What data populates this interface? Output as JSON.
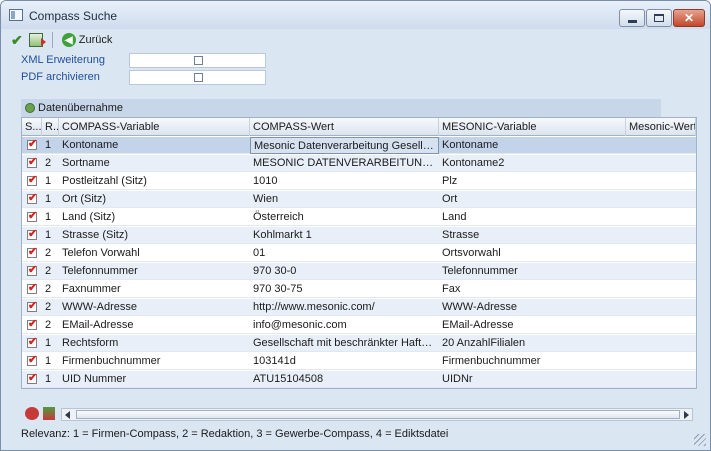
{
  "window": {
    "title": "Compass Suche"
  },
  "toolbar": {
    "back_label": "Zurück"
  },
  "fields": [
    {
      "label": "XML Erweiterung",
      "checked": false
    },
    {
      "label": "PDF archivieren",
      "checked": false
    }
  ],
  "panel": {
    "title": "Datenübernahme"
  },
  "grid": {
    "columns": [
      "S...",
      "R...",
      "COMPASS-Variable",
      "COMPASS-Wert",
      "MESONIC-Variable",
      "Mesonic-Wert"
    ],
    "rows": [
      {
        "checked": true,
        "r": "1",
        "var": "Kontoname",
        "val": "Mesonic Datenverarbeitung Gesellschaft...",
        "mvar": "Kontoname",
        "mval": ""
      },
      {
        "checked": true,
        "r": "2",
        "var": "Sortname",
        "val": "MESONIC DATENVERARBEITUNGS GESE...",
        "mvar": "Kontoname2",
        "mval": ""
      },
      {
        "checked": true,
        "r": "1",
        "var": "Postleitzahl (Sitz)",
        "val": "1010",
        "mvar": "Plz",
        "mval": ""
      },
      {
        "checked": true,
        "r": "1",
        "var": "Ort (Sitz)",
        "val": "Wien",
        "mvar": "Ort",
        "mval": ""
      },
      {
        "checked": true,
        "r": "1",
        "var": "Land (Sitz)",
        "val": "Österreich",
        "mvar": "Land",
        "mval": ""
      },
      {
        "checked": true,
        "r": "1",
        "var": "Strasse (Sitz)",
        "val": "Kohlmarkt 1",
        "mvar": "Strasse",
        "mval": ""
      },
      {
        "checked": true,
        "r": "2",
        "var": "Telefon Vorwahl",
        "val": "01",
        "mvar": "Ortsvorwahl",
        "mval": ""
      },
      {
        "checked": true,
        "r": "2",
        "var": "Telefonnummer",
        "val": "970 30-0",
        "mvar": "Telefonnummer",
        "mval": ""
      },
      {
        "checked": true,
        "r": "2",
        "var": "Faxnummer",
        "val": "970 30-75",
        "mvar": "Fax",
        "mval": ""
      },
      {
        "checked": true,
        "r": "2",
        "var": "WWW-Adresse",
        "val": "http://www.mesonic.com/",
        "mvar": "WWW-Adresse",
        "mval": ""
      },
      {
        "checked": true,
        "r": "2",
        "var": "EMail-Adresse",
        "val": "info@mesonic.com",
        "mvar": "EMail-Adresse",
        "mval": ""
      },
      {
        "checked": true,
        "r": "1",
        "var": "Rechtsform",
        "val": "Gesellschaft mit beschränkter Haftung",
        "mvar": "20 AnzahlFilialen",
        "mval": ""
      },
      {
        "checked": true,
        "r": "1",
        "var": "Firmenbuchnummer",
        "val": "103141d",
        "mvar": "Firmenbuchnummer",
        "mval": ""
      },
      {
        "checked": true,
        "r": "1",
        "var": "UID Nummer",
        "val": "ATU15104508",
        "mvar": "UIDNr",
        "mval": ""
      }
    ],
    "selected_row": 0
  },
  "status": {
    "text": "Relevanz: 1 = Firmen-Compass, 2 = Redaktion, 3 = Gewerbe-Compass, 4 = Ediktsdatei"
  }
}
